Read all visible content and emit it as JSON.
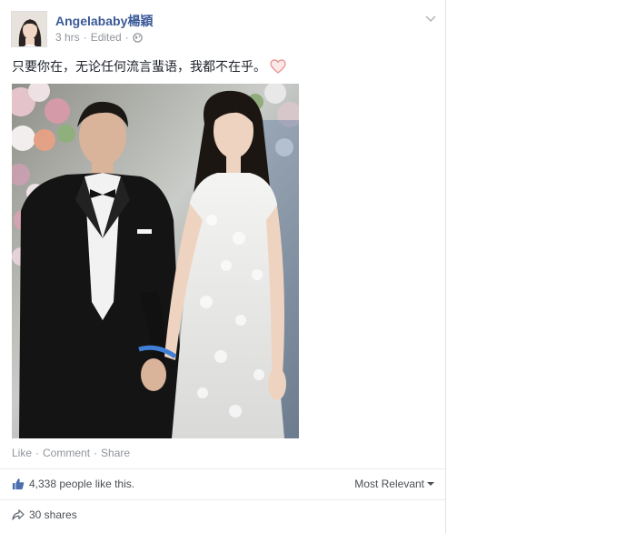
{
  "post": {
    "author_name": "Angelababy楊穎",
    "time": "3 hrs",
    "edited": "Edited",
    "separator": "·",
    "text": "只要你在，无论任何流言蜚语，我都不在乎。",
    "heart_icon": "heart-icon",
    "privacy_icon": "globe-icon"
  },
  "actions": {
    "like": "Like",
    "comment": "Comment",
    "share": "Share",
    "separator": "·"
  },
  "stats": {
    "likes_text": "4,338 people like this.",
    "sort_label": "Most Relevant",
    "shares_text": "30 shares"
  },
  "colors": {
    "link": "#3b5998",
    "meta": "#90949c",
    "heart": "#f5a6a6"
  }
}
